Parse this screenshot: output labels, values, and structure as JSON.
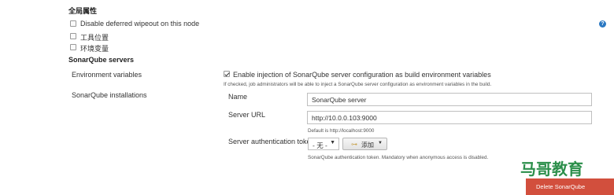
{
  "global": {
    "title": "全局属性",
    "options": [
      {
        "label": "Disable deferred wipeout on this node",
        "checked": false
      },
      {
        "label": "工具位置",
        "checked": false
      },
      {
        "label": "环境变量",
        "checked": false
      }
    ]
  },
  "sonar": {
    "title": "SonarQube servers",
    "env_label": "Environment variables",
    "env_checkbox_label": "Enable injection of SonarQube server configuration as build environment variables",
    "env_checked": true,
    "env_hint": "If checked, job administrators will be able to inject a SonarQube server configuration as environment variables in the build.",
    "installations_label": "SonarQube installations",
    "name_label": "Name",
    "name_value": "SonarQube server",
    "url_label": "Server URL",
    "url_value": "http://10.0.0.103:9000",
    "url_hint": "Default is http://localhost:9000",
    "token_label": "Server authentication token",
    "token_select": "- 无 -",
    "add_button": "添加",
    "token_hint": "SonarQube authentication token. Mandatory when anonymous access is disabled.",
    "delete_button": "Delete SonarQube"
  },
  "watermark": "马哥教育",
  "colors": {
    "delete_button": "#d24f3d",
    "watermark": "#2c8f4b",
    "help_icon": "#2a78c2"
  }
}
